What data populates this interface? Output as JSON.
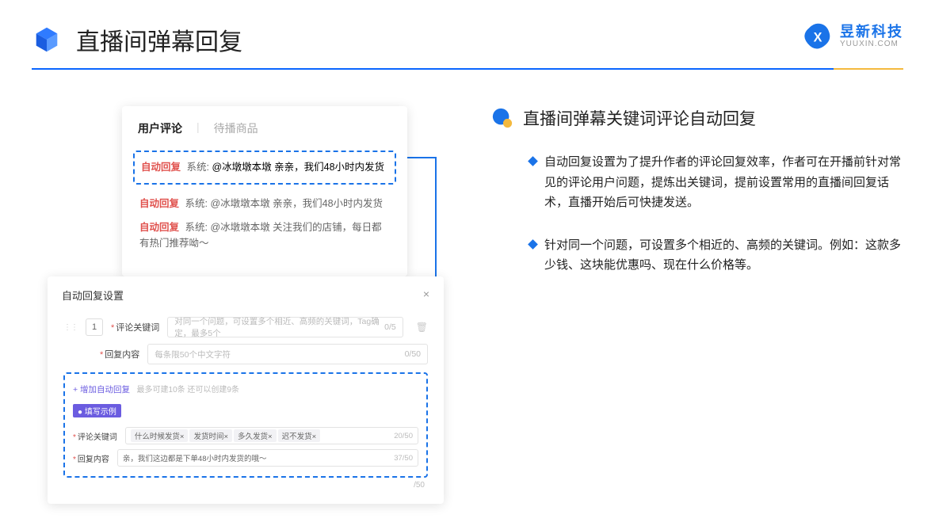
{
  "header": {
    "title": "直播间弹幕回复"
  },
  "logo": {
    "cn": "昱新科技",
    "en": "YUUXIN.COM"
  },
  "comments": {
    "tab_active": "用户评论",
    "tab_inactive": "待播商品",
    "auto_label": "自动回复",
    "sys_label": "系统:",
    "row1": "@冰墩墩本墩 亲亲，我们48小时内发货",
    "row2": "@冰墩墩本墩 亲亲，我们48小时内发货",
    "row3": "@冰墩墩本墩 关注我们的店铺，每日都有热门推荐呦～"
  },
  "settings": {
    "title": "自动回复设置",
    "idx": "1",
    "kw_label": "评论关键词",
    "kw_ph": "对同一个问题，可设置多个相近、高频的关键词，Tag确定，最多5个",
    "kw_count": "0/5",
    "content_label": "回复内容",
    "content_ph": "每条限50个中文字符",
    "content_count": "0/50",
    "add_link": "+ 增加自动回复",
    "add_hint": "最多可建10条 还可以创建9条",
    "example_badge": "● 填写示例",
    "ex_kw_label": "评论关键词",
    "ex_tags": [
      "什么时候发货×",
      "发货时间×",
      "多久发货×",
      "迟不发货×"
    ],
    "ex_kw_count": "20/50",
    "ex_content_label": "回复内容",
    "ex_content_val": "亲，我们这边都是下单48小时内发货的哦～",
    "ex_content_count": "37/50",
    "outer_count": "/50"
  },
  "feature": {
    "title": "直播间弹幕关键词评论自动回复",
    "b1": "自动回复设置为了提升作者的评论回复效率，作者可在开播前针对常见的评论用户问题，提炼出关键词，提前设置常用的直播间回复话术，直播开始后可快捷发送。",
    "b2": "针对同一个问题，可设置多个相近的、高频的关键词。例如：这款多少钱、这块能优惠吗、现在什么价格等。"
  }
}
